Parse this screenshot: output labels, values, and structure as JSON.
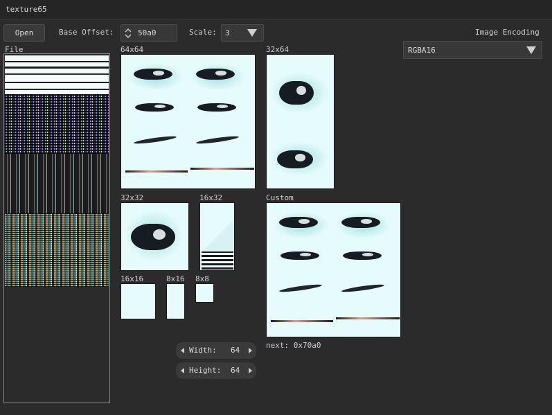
{
  "window": {
    "title": "texture65"
  },
  "toolbar": {
    "open_label": "Open",
    "base_offset_label": "Base Offset:",
    "base_offset_value": "50a0",
    "scale_label": "Scale:",
    "scale_value": "3"
  },
  "encoding": {
    "label": "Image Encoding",
    "value": "RGBA16"
  },
  "file_panel": {
    "label": "File"
  },
  "previews": {
    "p64x64": "64x64",
    "p32x64": "32x64",
    "p32x32": "32x32",
    "p16x32": "16x32",
    "p16x16": "16x16",
    "p8x16": "8x16",
    "p8x8": "8x8",
    "custom": "Custom"
  },
  "custom": {
    "width_label": "Width:",
    "width_value": "64",
    "height_label": "Height:",
    "height_value": "64",
    "next_text": "next: 0x70a0"
  },
  "icons": {
    "spin": "spin-up-down-icon",
    "dropdown": "triangle-down-icon",
    "left": "arrow-left-icon",
    "right": "arrow-right-icon"
  },
  "colors": {
    "background": "#2b2b2b",
    "texture_bg": "#e6fbfb",
    "eye": "#161d22"
  }
}
